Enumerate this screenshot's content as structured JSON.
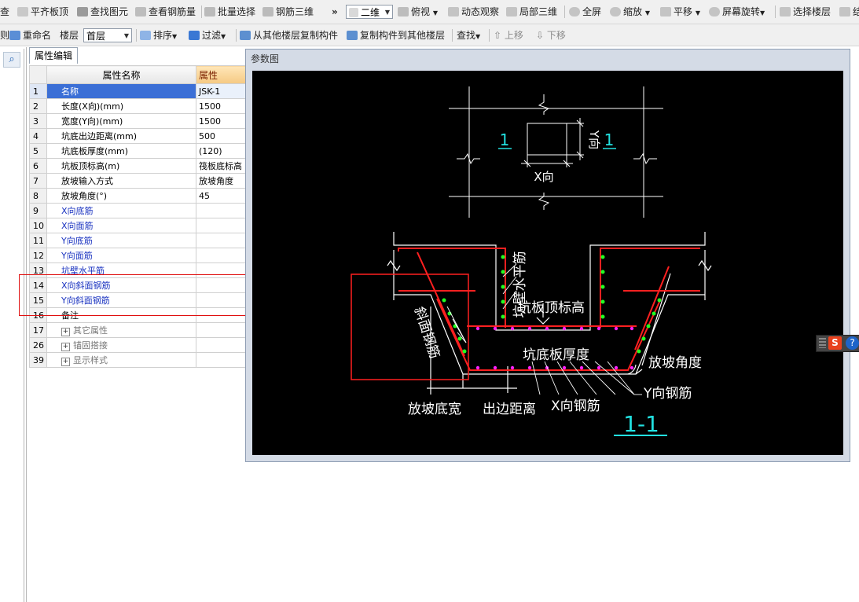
{
  "toolbar1": {
    "items": [
      "查",
      "平齐板顶",
      "查找图元",
      "查看钢筋量",
      "批量选择",
      "钢筋三维",
      "二维",
      "俯视",
      "动态观察",
      "局部三维",
      "全屏",
      "缩放",
      "平移",
      "屏幕旋转",
      "选择楼层",
      "结"
    ],
    "overflow": "»"
  },
  "toolbar2": {
    "items": [
      "则",
      "重命名",
      "楼层",
      "排序",
      "过滤",
      "从其他楼层复制构件",
      "复制构件到其他楼层",
      "查找",
      "上移",
      "下移"
    ],
    "floor_value": "首层"
  },
  "left_panel": {
    "tab": "属性编辑",
    "col_name": "属性名称",
    "col_value": "属性",
    "rows": [
      {
        "num": "1",
        "name": "名称",
        "value": "JSK-1"
      },
      {
        "num": "2",
        "name": "长度(X向)(mm)",
        "value": "1500"
      },
      {
        "num": "3",
        "name": "宽度(Y向)(mm)",
        "value": "1500"
      },
      {
        "num": "4",
        "name": "坑底出边距离(mm)",
        "value": "500"
      },
      {
        "num": "5",
        "name": "坑底板厚度(mm)",
        "value": "(120)"
      },
      {
        "num": "6",
        "name": "坑板顶标高(m)",
        "value": "筏板底标高"
      },
      {
        "num": "7",
        "name": "放坡输入方式",
        "value": "放坡角度"
      },
      {
        "num": "8",
        "name": "放坡角度(°)",
        "value": "45"
      },
      {
        "num": "9",
        "name": "X向底筋",
        "value": ""
      },
      {
        "num": "10",
        "name": "X向面筋",
        "value": ""
      },
      {
        "num": "11",
        "name": "Y向底筋",
        "value": ""
      },
      {
        "num": "12",
        "name": "Y向面筋",
        "value": ""
      },
      {
        "num": "13",
        "name": "坑壁水平筋",
        "value": ""
      },
      {
        "num": "14",
        "name": "X向斜面钢筋",
        "value": ""
      },
      {
        "num": "15",
        "name": "Y向斜面钢筋",
        "value": ""
      },
      {
        "num": "16",
        "name": "备注",
        "value": ""
      },
      {
        "num": "17",
        "name": "其它属性",
        "value": ""
      },
      {
        "num": "26",
        "name": "锚固搭接",
        "value": ""
      },
      {
        "num": "39",
        "name": "显示样式",
        "value": ""
      }
    ]
  },
  "dialog": {
    "title": "参数图",
    "plan": {
      "x_label": "X向",
      "y_label": "Y向",
      "section_mark": "1"
    },
    "section": {
      "wall_bar": "坑壁水平筋",
      "top_elev": "坑板顶标高",
      "slope_bar": "斜面钢筋",
      "slab_thk": "坑底板厚度",
      "slope_angle": "放坡角度",
      "y_bar": "Y向钢筋",
      "slope_width": "放坡底宽",
      "edge_dist": "出边距离",
      "x_bar": "X向钢筋",
      "section_title": "1-1"
    },
    "colors": {
      "bg": "#000000",
      "concrete": "#ffffff",
      "rebar": "#ff2020",
      "dot_green": "#22ff22",
      "dot_magenta": "#ff22ff",
      "accent": "#22e0e0"
    }
  },
  "side_widget": {
    "s": "S",
    "help": "?"
  }
}
